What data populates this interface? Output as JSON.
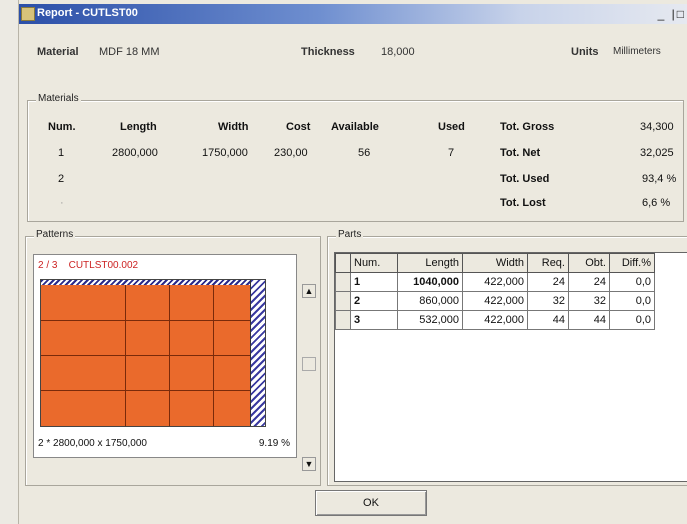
{
  "window": {
    "title": "Report - CUTLST00",
    "controls": "_ |□"
  },
  "header": {
    "material_label": "Material",
    "material_value": "MDF 18 MM",
    "thickness_label": "Thickness",
    "thickness_value": "18,000",
    "units_label": "Units",
    "units_value": "Millimeters"
  },
  "materials": {
    "group_title": "Materials",
    "columns": [
      "Num.",
      "Length",
      "Width",
      "Cost",
      "Available",
      "Used"
    ],
    "rows": [
      {
        "num": "1",
        "length": "2800,000",
        "width": "1750,000",
        "cost": "230,00",
        "available": "56",
        "used": "7"
      },
      {
        "num": "2"
      },
      {
        "num": "·"
      }
    ],
    "totals": [
      {
        "label": "Tot. Gross",
        "value": "34,300"
      },
      {
        "label": "Tot. Net",
        "value": "32,025"
      },
      {
        "label": "Tot. Used",
        "value": "93,4 %"
      },
      {
        "label": "Tot. Lost",
        "value": "6,6 %"
      }
    ]
  },
  "patterns": {
    "group_title": "Patterns",
    "pattern_index": "2 / 3",
    "pattern_name": "CUTLST00.002",
    "footer": "2 * 2800,000 x 1750,000",
    "percent": "9.19 %",
    "colors": {
      "panel": "#ea6a2c",
      "waste_hatch": "#3a3aa0"
    }
  },
  "parts": {
    "group_title": "Parts",
    "columns": [
      "Num.",
      "Length",
      "Width",
      "Req.",
      "Obt.",
      "Diff.%"
    ],
    "rows": [
      {
        "num": "1",
        "length": "1040,000",
        "width": "422,000",
        "req": "24",
        "obt": "24",
        "diff": "0,0"
      },
      {
        "num": "2",
        "length": "860,000",
        "width": "422,000",
        "req": "32",
        "obt": "32",
        "diff": "0,0"
      },
      {
        "num": "3",
        "length": "532,000",
        "width": "422,000",
        "req": "44",
        "obt": "44",
        "diff": "0,0"
      }
    ]
  },
  "footer": {
    "ok_label": "OK"
  }
}
